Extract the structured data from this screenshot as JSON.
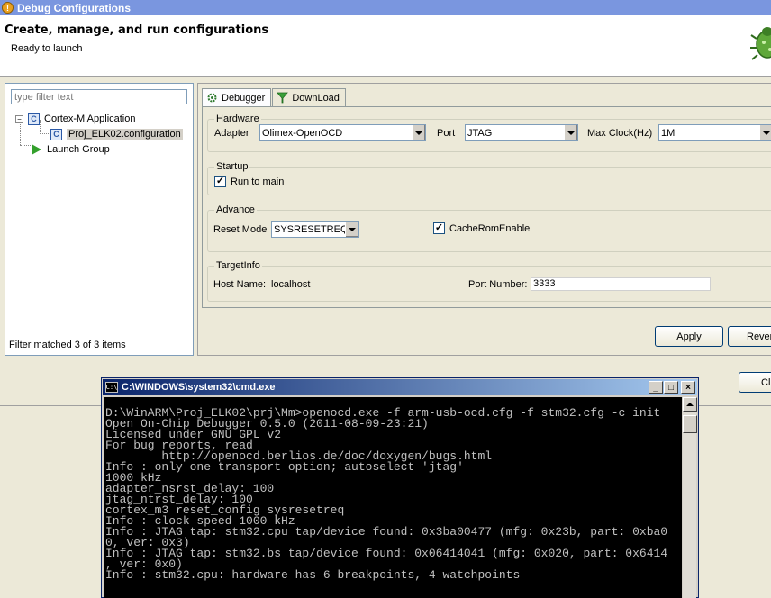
{
  "dialog": {
    "title": "Debug Configurations",
    "header_title": "Create, manage, and run configurations",
    "header_subtitle": "Ready to launch"
  },
  "left": {
    "filter_placeholder": "type filter text",
    "tree": [
      {
        "label": "Cortex-M Application",
        "icon": "cortex-m-config-icon",
        "expanded": true
      },
      {
        "label": "Proj_ELK02.configuration",
        "icon": "c-config-icon",
        "selected": true
      },
      {
        "label": "Launch Group",
        "icon": "launch-group-icon"
      }
    ],
    "filter_status": "Filter matched 3 of 3 items"
  },
  "tabs": [
    {
      "label": "Debugger",
      "icon": "debugger-gear-icon",
      "active": true
    },
    {
      "label": "DownLoad",
      "icon": "download-funnel-icon",
      "active": false
    }
  ],
  "hardware": {
    "title": "Hardware",
    "adapter_label": "Adapter",
    "adapter_value": "Olimex-OpenOCD",
    "port_label": "Port",
    "port_value": "JTAG",
    "maxclock_label": "Max Clock(Hz)",
    "maxclock_value": "1M"
  },
  "startup": {
    "title": "Startup",
    "run_to_main_label": "Run to main",
    "run_to_main_checked": true
  },
  "advance": {
    "title": "Advance",
    "reset_mode_label": "Reset Mode",
    "reset_mode_value": "SYSRESETREQ",
    "cache_rom_label": "CacheRomEnable",
    "cache_rom_checked": true
  },
  "targetinfo": {
    "title": "TargetInfo",
    "host_label": "Host Name:",
    "host_value": "localhost",
    "port_number_label": "Port Number:",
    "port_number_value": "3333"
  },
  "buttons": {
    "apply": "Apply",
    "revert": "Rever",
    "close": "Cl"
  },
  "cmd": {
    "title": "C:\\WINDOWS\\system32\\cmd.exe",
    "lines": [
      "D:\\WinARM\\Proj_ELK02\\prj\\Mm>openocd.exe -f arm-usb-ocd.cfg -f stm32.cfg -c init",
      "",
      "Open On-Chip Debugger 0.5.0 (2011-08-09-23:21)",
      "Licensed under GNU GPL v2",
      "For bug reports, read",
      "        http://openocd.berlios.de/doc/doxygen/bugs.html",
      "Info : only one transport option; autoselect 'jtag'",
      "1000 kHz",
      "adapter_nsrst_delay: 100",
      "jtag_ntrst_delay: 100",
      "cortex_m3 reset_config sysresetreq",
      "Info : clock speed 1000 kHz",
      "Info : JTAG tap: stm32.cpu tap/device found: 0x3ba00477 (mfg: 0x23b, part: 0xba0",
      "0, ver: 0x3)",
      "Info : JTAG tap: stm32.bs tap/device found: 0x06414041 (mfg: 0x020, part: 0x6414",
      ", ver: 0x0)",
      "Info : stm32.cpu: hardware has 6 breakpoints, 4 watchpoints"
    ]
  }
}
